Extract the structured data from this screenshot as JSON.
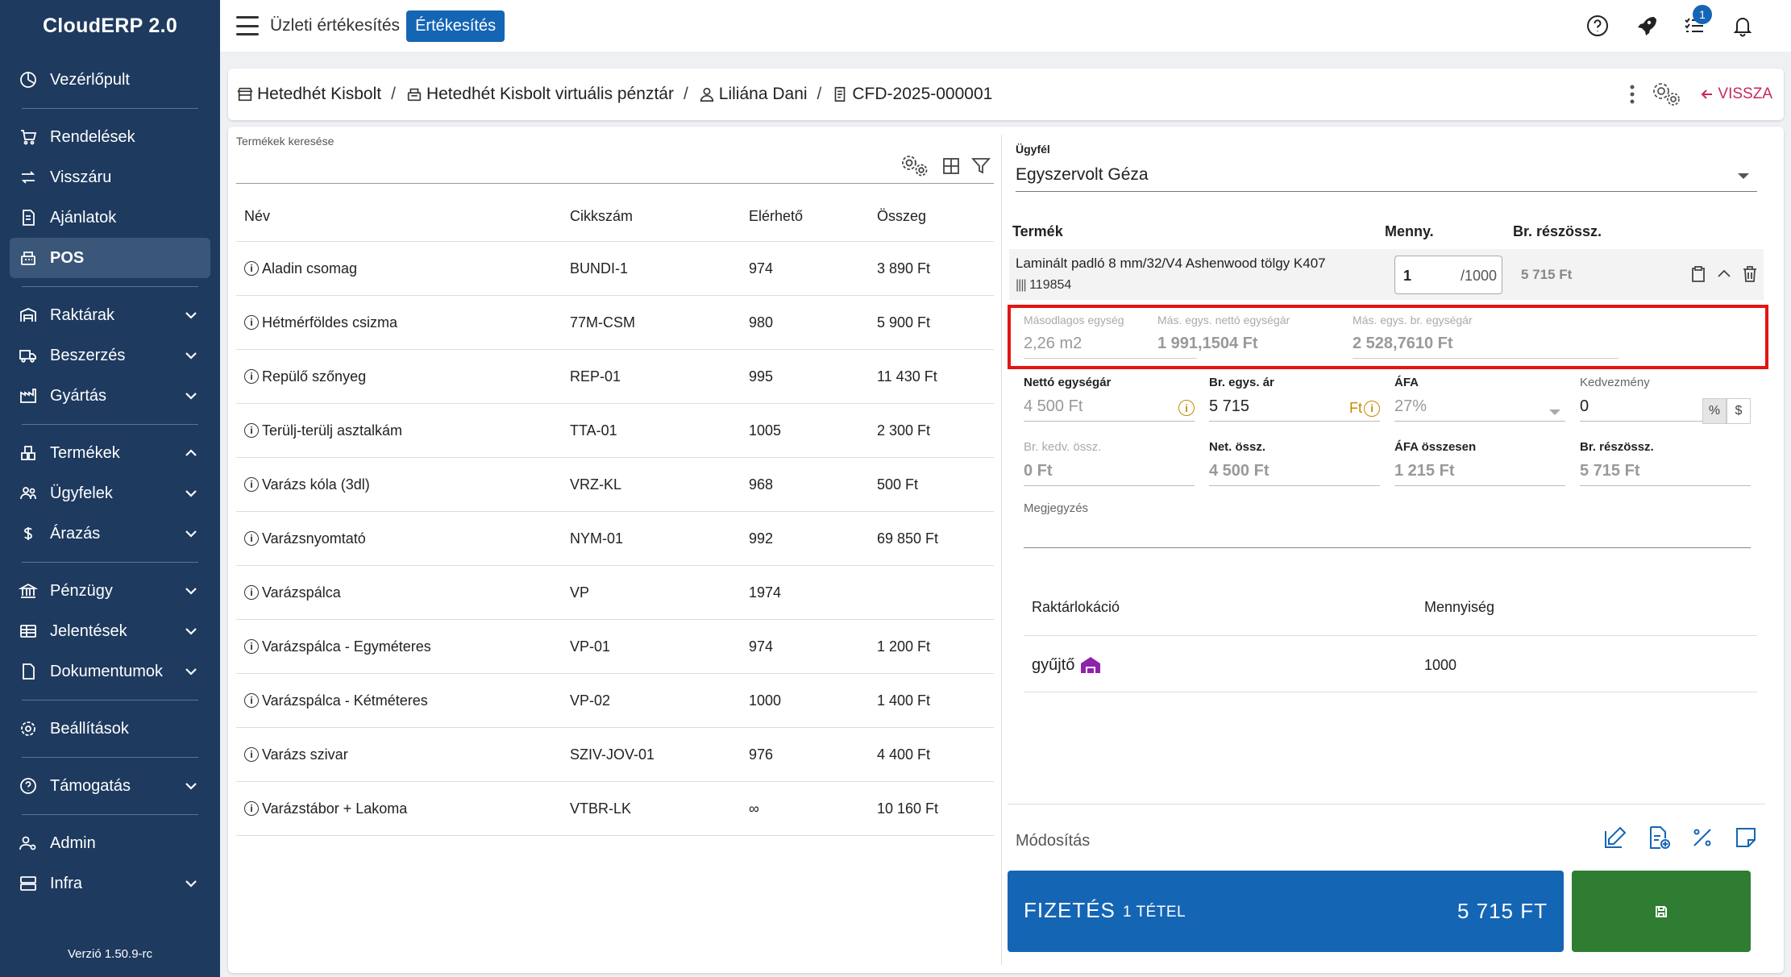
{
  "sidebar": {
    "brand": "CloudERP 2.0",
    "items": [
      {
        "label": "Vezérlőpult",
        "icon": "dashboard-icon"
      },
      {
        "label": "Rendelések",
        "icon": "cart-icon"
      },
      {
        "label": "Visszáru",
        "icon": "swap-icon"
      },
      {
        "label": "Ajánlatok",
        "icon": "document-icon"
      },
      {
        "label": "POS",
        "icon": "pos-icon",
        "active": true
      },
      {
        "label": "Raktárak",
        "icon": "warehouse-icon"
      },
      {
        "label": "Beszerzés",
        "icon": "truck-icon"
      },
      {
        "label": "Gyártás",
        "icon": "factory-icon"
      },
      {
        "label": "Termékek",
        "icon": "products-icon"
      },
      {
        "label": "Ügyfelek",
        "icon": "people-icon"
      },
      {
        "label": "Árazás",
        "icon": "dollar-icon"
      },
      {
        "label": "Pénzügy",
        "icon": "bank-icon"
      },
      {
        "label": "Jelentések",
        "icon": "table-icon"
      },
      {
        "label": "Dokumentumok",
        "icon": "file-icon"
      },
      {
        "label": "Beállítások",
        "icon": "gear-icon"
      },
      {
        "label": "Támogatás",
        "icon": "help-icon"
      },
      {
        "label": "Admin",
        "icon": "admin-icon"
      },
      {
        "label": "Infra",
        "icon": "server-icon"
      }
    ],
    "version": "Verzió 1.50.9-rc"
  },
  "topbar": {
    "title": "Üzleti értékesítés",
    "chip": "Értékesítés",
    "notification_count": "1"
  },
  "breadcrumb": {
    "store": "Hetedhét Kisbolt",
    "register": "Hetedhét Kisbolt virtuális pénztár",
    "user": "Liliána Dani",
    "document": "CFD-2025-000001",
    "back": "VISSZA"
  },
  "products": {
    "search_label": "Termékek keresése",
    "columns": {
      "name": "Név",
      "sku": "Cikkszám",
      "available": "Elérhető",
      "amount": "Összeg"
    },
    "rows": [
      {
        "name": "Aladin csomag",
        "sku": "BUNDI-1",
        "available": "974",
        "amount": "3 890 Ft"
      },
      {
        "name": "Hétmérföldes csizma",
        "sku": "77M-CSM",
        "available": "980",
        "amount": "5 900 Ft"
      },
      {
        "name": "Repülő szőnyeg",
        "sku": "REP-01",
        "available": "995",
        "amount": "11 430 Ft"
      },
      {
        "name": "Terülj-terülj asztalkám",
        "sku": "TTA-01",
        "available": "1005",
        "amount": "2 300 Ft"
      },
      {
        "name": "Varázs kóla (3dl)",
        "sku": "VRZ-KL",
        "available": "968",
        "amount": "500 Ft"
      },
      {
        "name": "Varázsnyomtató",
        "sku": "NYM-01",
        "available": "992",
        "amount": "69 850 Ft"
      },
      {
        "name": "Varázspálca",
        "sku": "VP",
        "available": "1974",
        "amount": ""
      },
      {
        "name": "Varázspálca - Egyméteres",
        "sku": "VP-01",
        "available": "974",
        "amount": "1 200 Ft"
      },
      {
        "name": "Varázspálca - Kétméteres",
        "sku": "VP-02",
        "available": "1000",
        "amount": "1 400 Ft"
      },
      {
        "name": "Varázs szivar",
        "sku": "SZIV-JOV-01",
        "available": "976",
        "amount": "4 400 Ft"
      },
      {
        "name": "Varázstábor + Lakoma",
        "sku": "VTBR-LK",
        "available": "∞",
        "amount": "10 160 Ft"
      }
    ]
  },
  "cart": {
    "customer_label": "Ügyfél",
    "customer": "Egyszervolt Géza",
    "headers": {
      "product": "Termék",
      "qty": "Menny.",
      "gross": "Br. részössz."
    },
    "item": {
      "name": "Laminált padló 8 mm/32/V4 Ashenwood tölgy K407",
      "barcode": "119854",
      "qty": "1",
      "qty_max": "/1000",
      "total": "5 715 Ft"
    },
    "secondary": {
      "unit_label": "Másodlagos egység",
      "unit_value": "2,26 m2",
      "net_label": "Más. egys. nettó egységár",
      "net_value": "1 991,1504 Ft",
      "gross_label": "Más. egys. br. egységár",
      "gross_value": "2 528,7610 Ft"
    },
    "fields": {
      "net_unit_label": "Nettó egységár",
      "net_unit_value": "4 500 Ft",
      "gross_unit_label": "Br. egys. ár",
      "gross_unit_value": "5 715",
      "gross_unit_suffix": "Ft",
      "vat_label": "ÁFA",
      "vat_value": "27%",
      "discount_label": "Kedvezmény",
      "discount_value": "0",
      "disc_pct": "%",
      "disc_abs": "$",
      "gross_disc_label": "Br. kedv. össz.",
      "gross_disc_value": "0 Ft",
      "net_total_label": "Net. össz.",
      "net_total_value": "4 500 Ft",
      "vat_total_label": "ÁFA összesen",
      "vat_total_value": "1 215 Ft",
      "gross_total_label": "Br. részössz.",
      "gross_total_value": "5 715 Ft",
      "note_label": "Megjegyzés"
    },
    "locations": {
      "col_location": "Raktárlokáció",
      "col_qty": "Mennyiség",
      "rows": [
        {
          "location": "gyűjtő",
          "qty": "1000"
        }
      ]
    },
    "modify_label": "Módosítás",
    "pay": {
      "label": "FIZETÉS",
      "count": "1 TÉTEL",
      "total": "5 715 FT"
    },
    "colors": {
      "primary": "#1565b5",
      "save": "#2e7d32",
      "highlight": "#e41414",
      "sidebar": "#1e3a5f"
    }
  }
}
